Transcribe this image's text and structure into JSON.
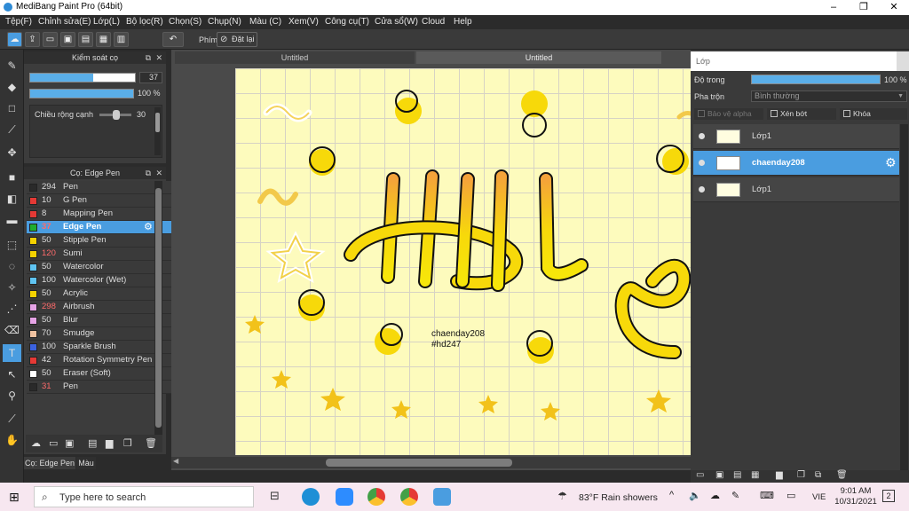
{
  "window": {
    "title": "MediBang Paint Pro (64bit)",
    "min": "–",
    "max": "❐",
    "close": "✕"
  },
  "menu": [
    "Tệp(F)",
    "Chỉnh sửa(E)",
    "Lớp(L)",
    "Bộ lọc(R)",
    "Chọn(S)",
    "Chụp(N)",
    "Màu (C)",
    "Xem(V)",
    "Công cụ(T)",
    "Cửa sổ(W)",
    "Cloud",
    "Help"
  ],
  "toolbar": {
    "phim_label": "Phím",
    "reset_label": "Đặt lại"
  },
  "brush_control": {
    "title": "Kiểm soát cọ",
    "size_value": "37",
    "opacity_value": "100 %",
    "edge_width_label": "Chiều rộng cạnh",
    "edge_width_value": "30",
    "size_fraction": 0.6,
    "opacity_fraction": 1.0,
    "edge_fraction": 0.3
  },
  "brush_panel": {
    "title": "Cọ: Edge Pen",
    "items": [
      {
        "size": "294",
        "name": "Pen",
        "color": "#2a2a2a",
        "red": false
      },
      {
        "size": "10",
        "name": "G Pen",
        "color": "#e53935",
        "red": false
      },
      {
        "size": "8",
        "name": "Mapping Pen",
        "color": "#e53935",
        "red": false
      },
      {
        "size": "37",
        "name": "Edge Pen",
        "color": "#1fae2f",
        "red": true
      },
      {
        "size": "50",
        "name": "Stipple Pen",
        "color": "#f5d200",
        "red": false
      },
      {
        "size": "120",
        "name": "Sumi",
        "color": "#f5d200",
        "red": true
      },
      {
        "size": "50",
        "name": "Watercolor",
        "color": "#5fc4f2",
        "red": false
      },
      {
        "size": "100",
        "name": "Watercolor (Wet)",
        "color": "#5fc4f2",
        "red": false
      },
      {
        "size": "50",
        "name": "Acrylic",
        "color": "#f5d200",
        "red": false
      },
      {
        "size": "298",
        "name": "Airbrush",
        "color": "#e5a3e5",
        "red": true
      },
      {
        "size": "50",
        "name": "Blur",
        "color": "#e5a3e5",
        "red": false
      },
      {
        "size": "70",
        "name": "Smudge",
        "color": "#f0c2a0",
        "red": false
      },
      {
        "size": "100",
        "name": "Sparkle Brush",
        "color": "#3b62e0",
        "red": false
      },
      {
        "size": "42",
        "name": "Rotation Symmetry Pen",
        "color": "#e53935",
        "red": false
      },
      {
        "size": "50",
        "name": "Eraser (Soft)",
        "color": "#ffffff",
        "red": false
      },
      {
        "size": "31",
        "name": "Pen",
        "color": "#2a2a2a",
        "red": true
      }
    ],
    "selected_index": 3,
    "bottom_tabs": [
      "Cọ: Edge Pen",
      "Màu"
    ]
  },
  "canvas": {
    "tabs": [
      "Untitled",
      "Untitled"
    ],
    "text_line1": "chaenday208",
    "text_line2": "#hd247",
    "hscroll_fraction": 0.45
  },
  "layers_panel": {
    "title": "Lớp",
    "opacity_label": "Độ trong",
    "opacity_value": "100 %",
    "blend_label": "Pha trộn",
    "blend_value": "Bình thường",
    "protect_alpha": "Bảo vệ alpha",
    "clipping": "Xén bớt",
    "lock": "Khóa",
    "layers": [
      {
        "name": "Lớp1",
        "selected": false
      },
      {
        "name": "chaenday208",
        "selected": true
      },
      {
        "name": "Lớp1",
        "selected": false
      }
    ]
  },
  "taskbar": {
    "search_placeholder": "Type here to search",
    "weather": "83°F  Rain showers",
    "lang": "VIE",
    "time": "9:01 AM",
    "date": "10/31/2021",
    "notifications": "2"
  },
  "colors": {
    "accent": "#4a9de0",
    "canvas_bg": "#fdfbbd",
    "ink_yellow": "#f7d90a",
    "ink_orange": "#f4a33a"
  }
}
